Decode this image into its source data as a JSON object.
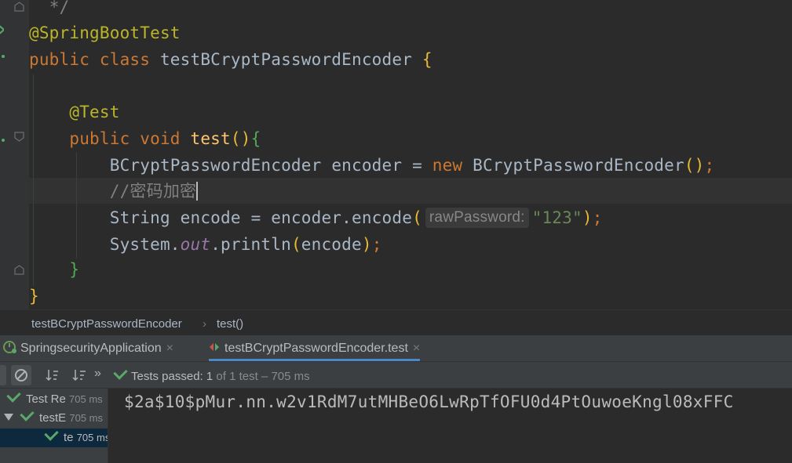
{
  "editor": {
    "lines": [
      {
        "comment_end": "*/"
      },
      {
        "annotation": "@SpringBootTest"
      },
      {
        "kw_public": "public",
        "kw_class": "class",
        "class_name": "testBCryptPasswordEncoder",
        "brace": "{"
      },
      {
        "annotation": "@Test"
      },
      {
        "kw_public": "public",
        "kw_void": "void",
        "method": "test",
        "parens": "()",
        "brace": "{"
      },
      {
        "type": "BCryptPasswordEncoder",
        "var": "encoder",
        "eq": "=",
        "kw_new": "new",
        "ctor": "BCryptPasswordEncoder",
        "parens": "()",
        "semi": ";"
      },
      {
        "comment": "//密码加密"
      },
      {
        "type": "String",
        "var": "encode",
        "eq": "=",
        "call": "encoder.encode",
        "open": "(",
        "hint": "rawPassword:",
        "str": "\"123\"",
        "close": ")",
        "semi": ";"
      },
      {
        "obj": "System.",
        "field": "out",
        "call": ".println",
        "open": "(",
        "arg": "encode",
        "close": ")",
        "semi": ";"
      },
      {
        "brace": "}"
      },
      {
        "brace": "}"
      }
    ]
  },
  "breadcrumb": {
    "items": [
      "testBCryptPasswordEncoder",
      "test()"
    ],
    "separator": "›"
  },
  "run_tabs": [
    {
      "label": "SpringsecurityApplication",
      "close": "×"
    },
    {
      "label": "testBCryptPasswordEncoder.test",
      "close": "×"
    }
  ],
  "toolbar": {
    "status_prefix": "Tests passed:",
    "count": "1",
    "of_total": "of 1 test",
    "duration": "– 705 ms"
  },
  "tree": [
    {
      "label": "Test Re",
      "time": "705 ms"
    },
    {
      "label": "testE",
      "time": "705 ms"
    },
    {
      "label": "te",
      "time": "705 ms"
    }
  ],
  "output": {
    "text": "$2a$10$pMur.nn.w2v1RdM7utMHBeO6LwRpTfOFU0d4PtOuwoeKngl08xFFC"
  },
  "colors": {
    "keyword": "#cc7832",
    "annotation": "#bbb529",
    "method": "#ffc66d",
    "string": "#6a8759",
    "accent": "#4a88c7",
    "pass": "#59a869"
  }
}
